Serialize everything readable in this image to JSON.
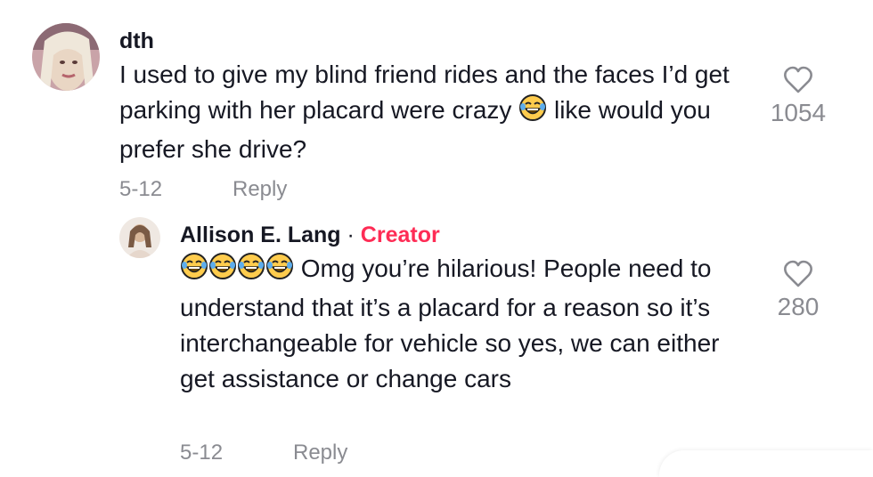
{
  "comments": [
    {
      "username": "dth",
      "body": "I used to give my blind friend rides and the faces I’d get parking with her placard were crazy",
      "body_after_emoji": " like would you prefer she drive?",
      "emoji": "face-with-tears-of-joy-icon",
      "date": "5-12",
      "reply_label": "Reply",
      "like_count": "1054"
    },
    {
      "username": "Allison E. Lang",
      "separator": " · ",
      "creator_label": "Creator",
      "emoji_count": 4,
      "emoji": "face-with-tears-of-joy-icon",
      "body": " Omg you’re hilarious! People need to understand that it’s a placard for a reason so it’s interchangeable for vehicle so yes, we can either get assistance or change cars",
      "date": "5-12",
      "reply_label": "Reply",
      "like_count": "280"
    }
  ],
  "colors": {
    "text": "#161823",
    "muted": "#8a8b91",
    "creator": "#fe2c55",
    "emoji_face": "#ffcc4d",
    "emoji_tear": "#5dadec"
  }
}
